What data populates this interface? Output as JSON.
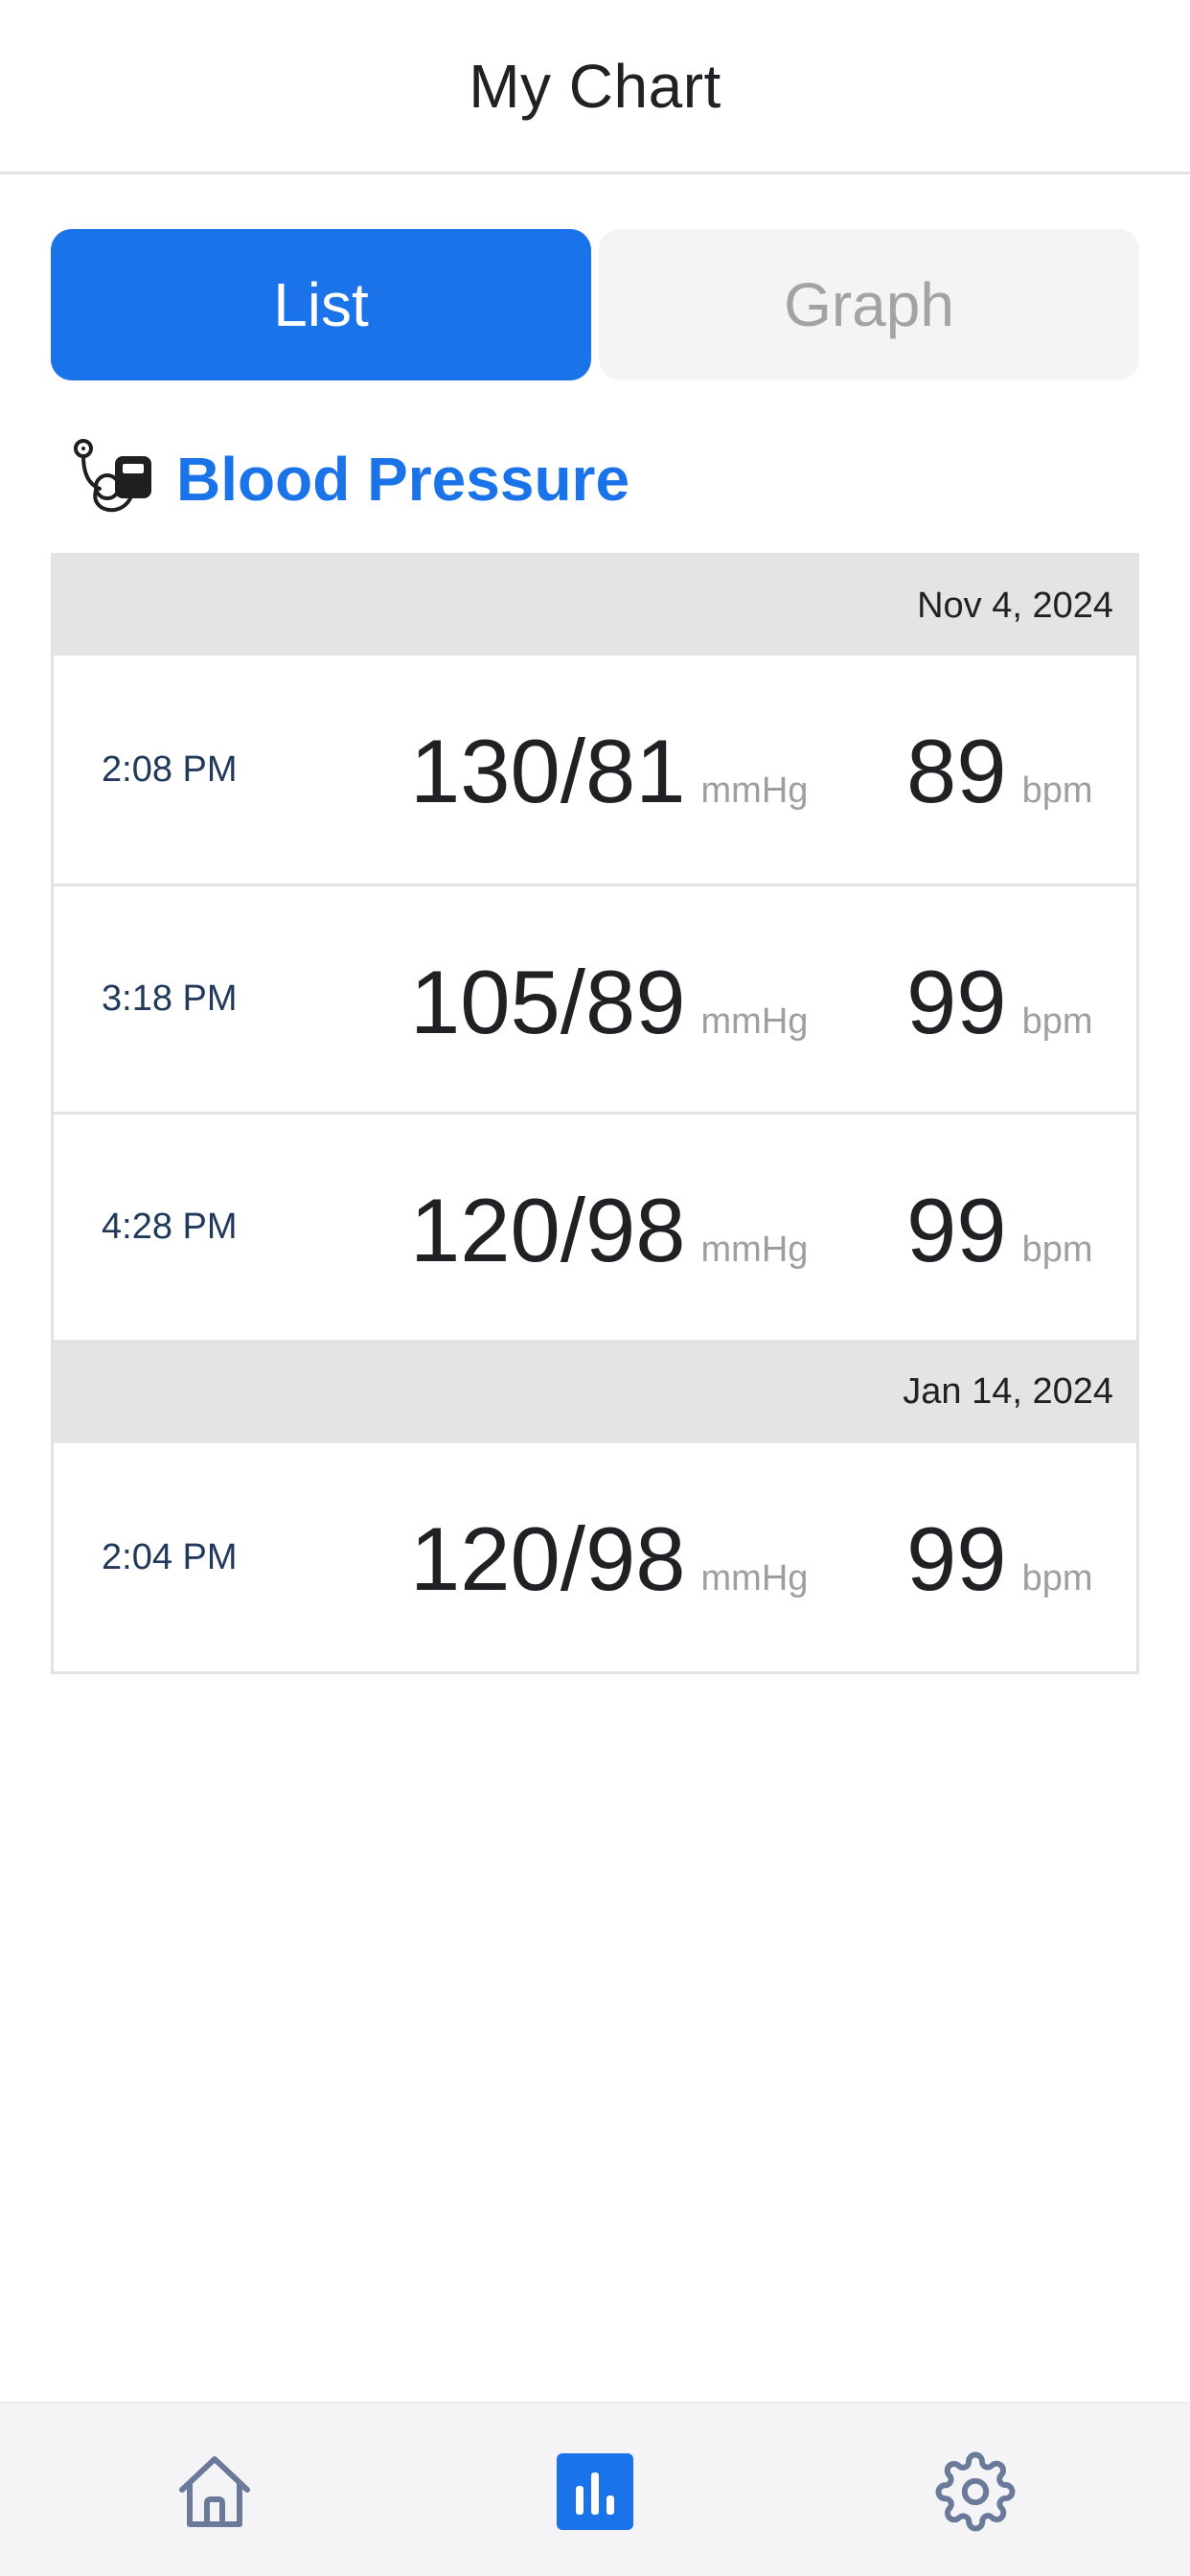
{
  "header": {
    "title": "My Chart"
  },
  "view_toggle": {
    "list_label": "List",
    "graph_label": "Graph",
    "selected": "List"
  },
  "section": {
    "title": "Blood Pressure",
    "icon": "blood-pressure-monitor-icon"
  },
  "groups": [
    {
      "date": "Nov 4, 2024",
      "readings": [
        {
          "time": "2:08 PM",
          "bp": "130/81",
          "bp_unit": "mmHg",
          "pulse": "89",
          "pulse_unit": "bpm"
        },
        {
          "time": "3:18 PM",
          "bp": "105/89",
          "bp_unit": "mmHg",
          "pulse": "99",
          "pulse_unit": "bpm"
        },
        {
          "time": "4:28 PM",
          "bp": "120/98",
          "bp_unit": "mmHg",
          "pulse": "99",
          "pulse_unit": "bpm"
        }
      ]
    },
    {
      "date": "Jan 14, 2024",
      "readings": [
        {
          "time": "2:04 PM",
          "bp": "120/98",
          "bp_unit": "mmHg",
          "pulse": "99",
          "pulse_unit": "bpm"
        }
      ]
    }
  ],
  "bottom_nav": {
    "items": [
      {
        "icon": "home-icon"
      },
      {
        "icon": "bar-chart-icon",
        "active": true
      },
      {
        "icon": "gear-icon"
      }
    ],
    "active_color": "#1a73e8",
    "inactive_color": "#6b7a99"
  },
  "colors": {
    "accent": "#1a73e8",
    "time_text": "#213a5c",
    "unit_text": "#9e9e9e",
    "date_bar": "#e4e4e4"
  }
}
